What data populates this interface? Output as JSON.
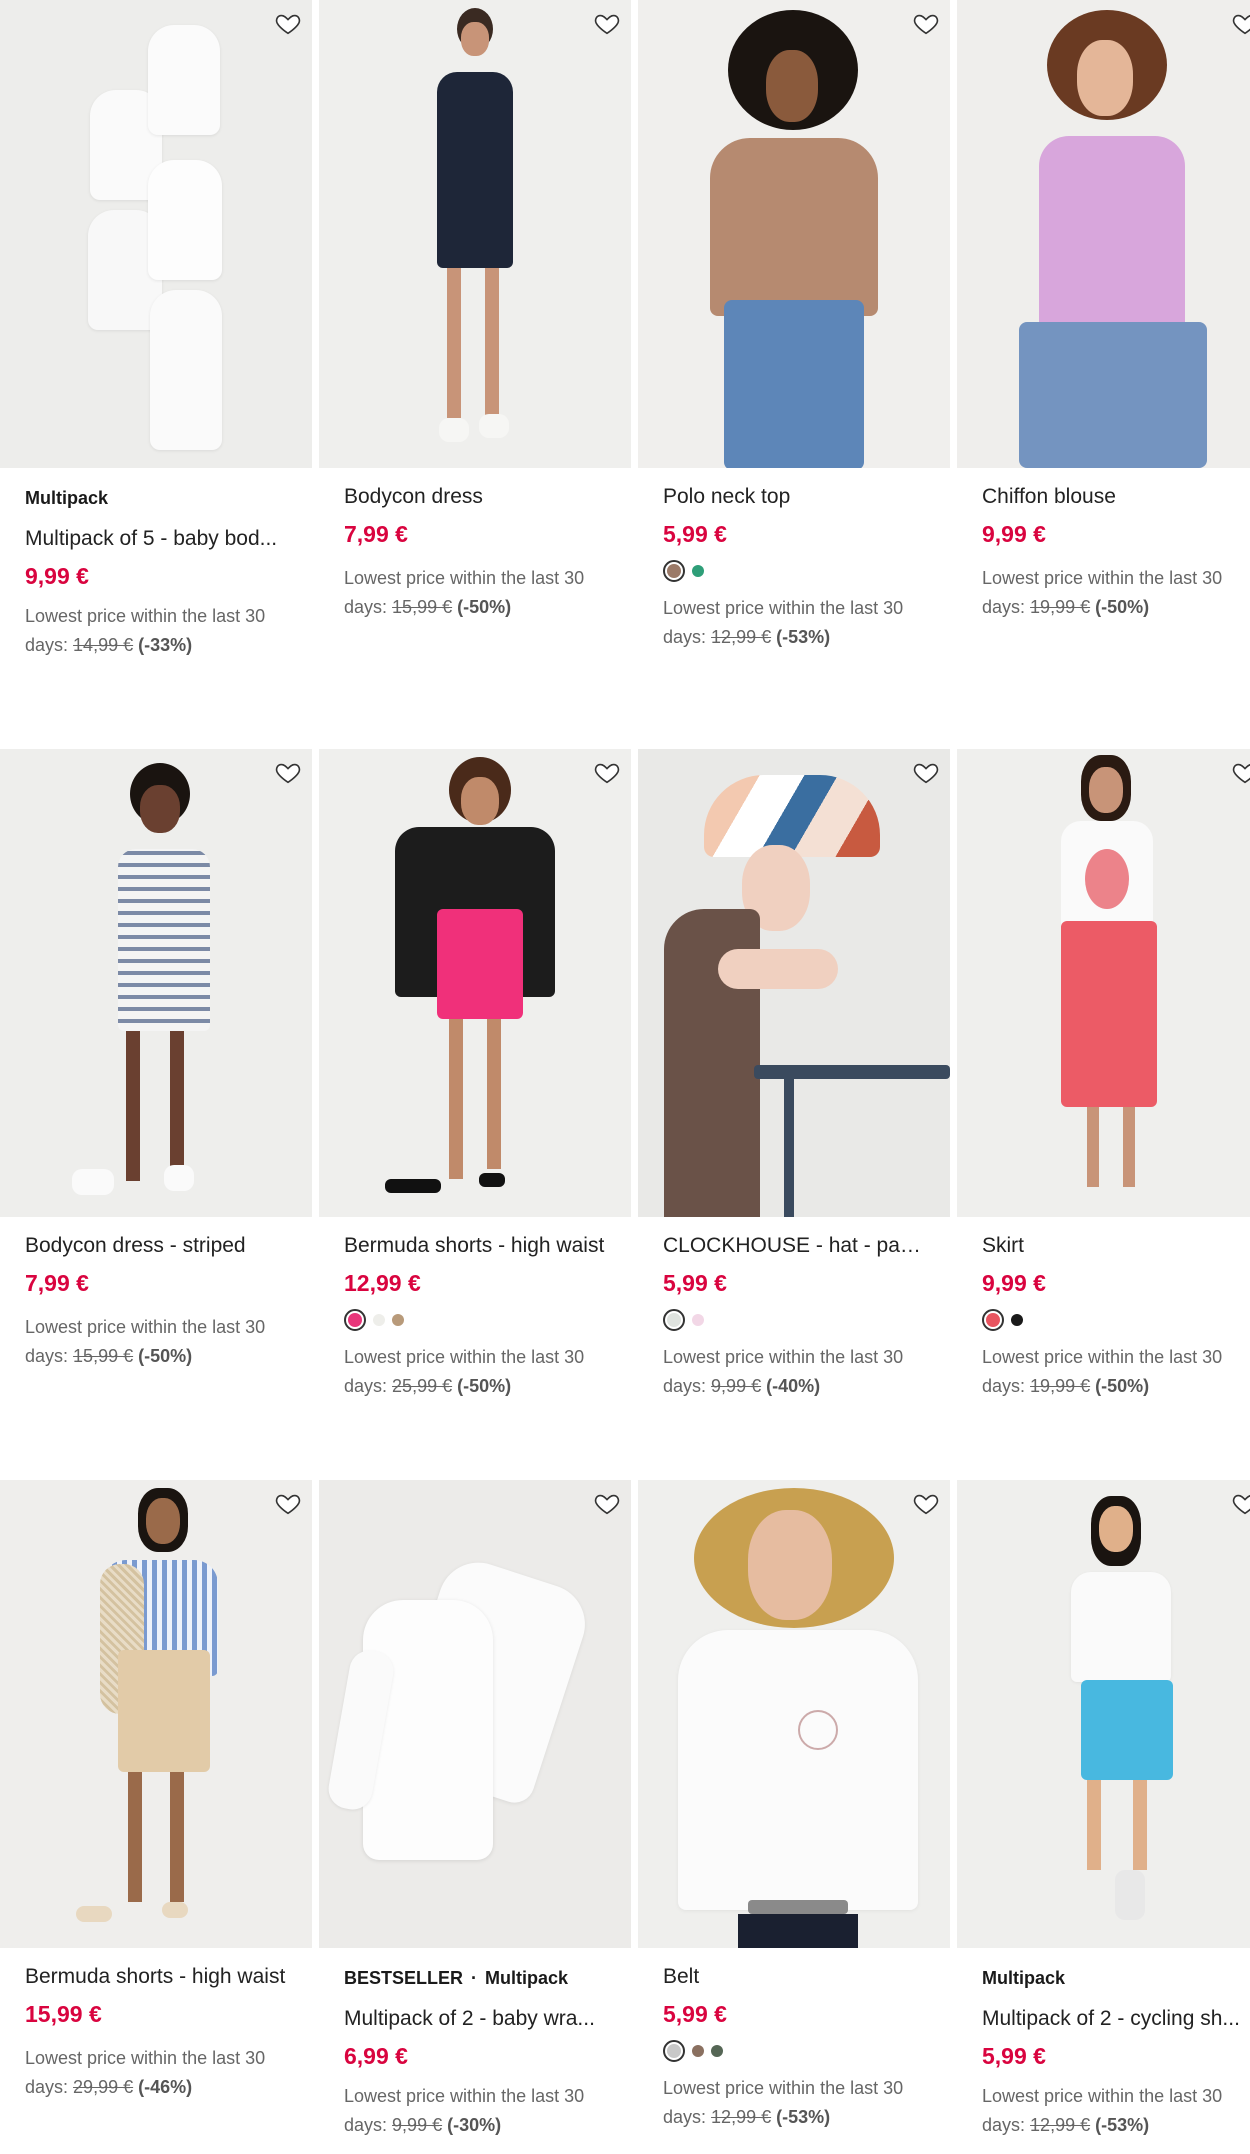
{
  "products": [
    {
      "tagline": "Multipack",
      "tagline2": "",
      "name": "Multipack of 5 - baby bod...",
      "price": "9,99 €",
      "lowest_label": "Lowest price within the last 30",
      "days_label": "days:",
      "old_price": "14,99 €",
      "discount": "(-33%)",
      "image": "white-baby-bodysuits"
    },
    {
      "tagline": "",
      "tagline2": "",
      "name": "Bodycon dress",
      "price": "7,99 €",
      "lowest_label": "Lowest price within the last 30",
      "days_label": "days:",
      "old_price": "15,99 €",
      "discount": "(-50%)",
      "image": "navy-bodycon-dress"
    },
    {
      "tagline": "",
      "tagline2": "",
      "name": "Polo neck top",
      "price": "5,99 €",
      "lowest_label": "Lowest price within the last 30",
      "days_label": "days:",
      "old_price": "12,99 €",
      "discount": "(-53%)",
      "image": "brown-polo-neck-top",
      "swatches": [
        "#9b7a68",
        "#2e9e78"
      ]
    },
    {
      "tagline": "",
      "tagline2": "",
      "name": "Chiffon blouse",
      "price": "9,99 €",
      "lowest_label": "Lowest price within the last 30",
      "days_label": "days:",
      "old_price": "19,99 €",
      "discount": "(-50%)",
      "image": "lilac-chiffon-blouse"
    },
    {
      "tagline": "",
      "tagline2": "",
      "name": "Bodycon dress - striped",
      "price": "7,99 €",
      "lowest_label": "Lowest price within the last 30",
      "days_label": "days:",
      "old_price": "15,99 €",
      "discount": "(-50%)",
      "image": "striped-bodycon-dress"
    },
    {
      "tagline": "",
      "tagline2": "",
      "name": "Bermuda shorts - high waist",
      "price": "12,99 €",
      "lowest_label": "Lowest price within the last 30",
      "days_label": "days:",
      "old_price": "25,99 €",
      "discount": "(-50%)",
      "image": "pink-bermuda-shorts",
      "swatches": [
        "#e8357a",
        "#eeeeea",
        "#b89a7a"
      ]
    },
    {
      "tagline": "",
      "tagline2": "",
      "name": "CLOCKHOUSE - hat - patt...",
      "price": "5,99 €",
      "lowest_label": "Lowest price within the last 30",
      "days_label": "days:",
      "old_price": "9,99 €",
      "discount": "(-40%)",
      "image": "patterned-bucket-hat",
      "swatches": [
        "#dfe3df",
        "#f2d7e6"
      ]
    },
    {
      "tagline": "",
      "tagline2": "",
      "name": "Skirt",
      "price": "9,99 €",
      "lowest_label": "Lowest price within the last 30",
      "days_label": "days:",
      "old_price": "19,99 €",
      "discount": "(-50%)",
      "image": "coral-skirt",
      "swatches": [
        "#e8545f",
        "#1a1a1a"
      ]
    },
    {
      "tagline": "",
      "tagline2": "",
      "name": "Bermuda shorts - high waist",
      "price": "15,99 €",
      "lowest_label": "Lowest price within the last 30",
      "days_label": "days:",
      "old_price": "29,99 €",
      "discount": "(-46%)",
      "image": "beige-bermuda-shorts"
    },
    {
      "tagline": "BESTSELLER",
      "tagline2": "Multipack",
      "name": "Multipack of 2 - baby wra...",
      "price": "6,99 €",
      "lowest_label": "Lowest price within the last 30",
      "days_label": "days:",
      "old_price": "9,99 €",
      "discount": "(-30%)",
      "image": "white-baby-wrap-bodysuits"
    },
    {
      "tagline": "",
      "tagline2": "",
      "name": "Belt",
      "price": "5,99 €",
      "lowest_label": "Lowest price within the last 30",
      "days_label": "days:",
      "old_price": "12,99 €",
      "discount": "(-53%)",
      "image": "grey-belt",
      "swatches": [
        "#c8c8c8",
        "#8a7060",
        "#556655"
      ]
    },
    {
      "tagline": "Multipack",
      "tagline2": "",
      "name": "Multipack of 2 - cycling sh...",
      "price": "5,99 €",
      "lowest_label": "Lowest price within the last 30",
      "days_label": "days:",
      "old_price": "12,99 €",
      "discount": "(-53%)",
      "image": "blue-cycling-shorts"
    }
  ],
  "colors": {
    "price": "#d9043f",
    "text": "#222222",
    "muted": "#666666"
  },
  "icons": {
    "favourite": "heart-outline-icon"
  }
}
